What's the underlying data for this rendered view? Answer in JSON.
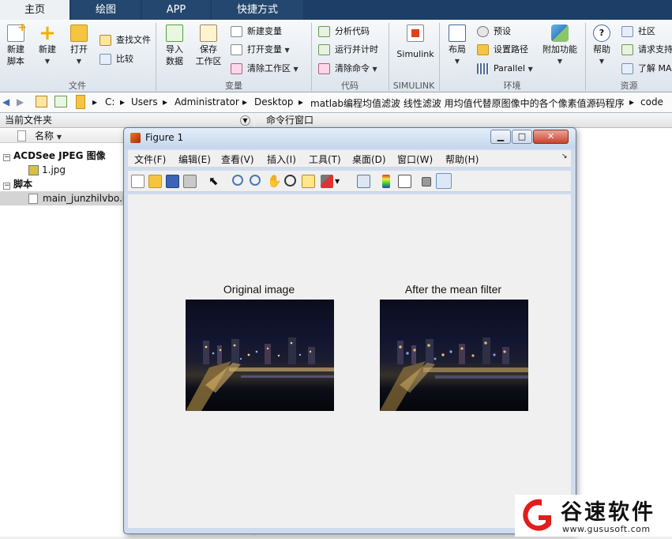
{
  "tabs": [
    "主页",
    "绘图",
    "APP",
    "快捷方式"
  ],
  "groups": [
    "文件",
    "变量",
    "代码",
    "SIMULINK",
    "环境",
    "资源"
  ],
  "file_group": {
    "new_script": "新建\n脚本",
    "new": "新建",
    "open": "打开",
    "find_files": "查找文件",
    "compare": "比较"
  },
  "var_group": {
    "import": "导入\n数据",
    "save_ws": "保存\n工作区",
    "new_var": "新建变量",
    "open_var": "打开变量",
    "clear_ws": "清除工作区"
  },
  "code_group": {
    "analyze": "分析代码",
    "run_time": "运行并计时",
    "clear_cmd": "清除命令"
  },
  "simulink_group": {
    "simulink": "Simulink"
  },
  "env_group": {
    "layout": "布局",
    "prefs": "预设",
    "set_path": "设置路径",
    "parallel": "Parallel",
    "addons": "附加功能"
  },
  "res_group": {
    "help": "帮助",
    "community": "社区",
    "request_support": "请求支持",
    "learn": "了解 MA"
  },
  "address": {
    "parts": [
      "C:",
      "Users",
      "Administrator",
      "Desktop",
      "matlab编程均值滤波 线性滤波 用均值代替原图像中的各个像素值源码程序",
      "code"
    ]
  },
  "current_folder": {
    "title": "当前文件夹",
    "name_col": "名称",
    "group1": "ACDSee JPEG 图像",
    "file1": "1.jpg",
    "group2": "脚本",
    "file2": "main_junzhilvbo.m"
  },
  "command_window": {
    "title": "命令行窗口"
  },
  "figure": {
    "title": "Figure 1",
    "menus": [
      "文件(F)",
      "编辑(E)",
      "查看(V)",
      "插入(I)",
      "工具(T)",
      "桌面(D)",
      "窗口(W)",
      "帮助(H)"
    ],
    "left_title": "Original image",
    "right_title": "After the mean filter"
  },
  "watermark": {
    "brand": "谷速软件",
    "url": "www.gususoft.com"
  }
}
